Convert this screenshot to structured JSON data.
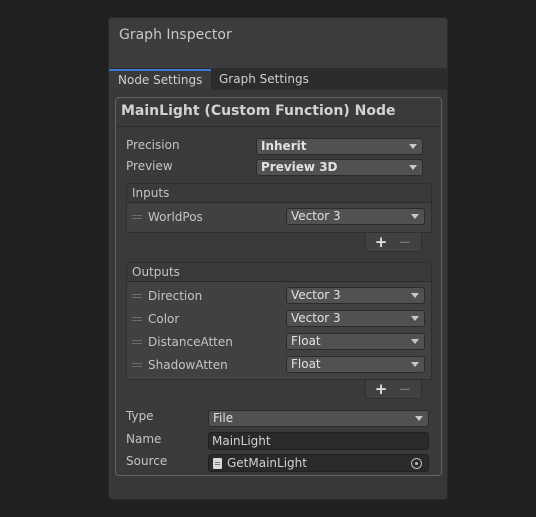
{
  "window": {
    "title": "Graph Inspector"
  },
  "tabs": [
    {
      "label": "Node Settings",
      "active": true
    },
    {
      "label": "Graph Settings",
      "active": false
    }
  ],
  "node": {
    "title": "MainLight (Custom Function) Node",
    "precision": {
      "label": "Precision",
      "value": "Inherit"
    },
    "preview": {
      "label": "Preview",
      "value": "Preview 3D"
    },
    "inputs": {
      "header": "Inputs",
      "rows": [
        {
          "name": "WorldPos",
          "type": "Vector 3"
        }
      ]
    },
    "outputs": {
      "header": "Outputs",
      "rows": [
        {
          "name": "Direction",
          "type": "Vector 3"
        },
        {
          "name": "Color",
          "type": "Vector 3"
        },
        {
          "name": "DistanceAtten",
          "type": "Float"
        },
        {
          "name": "ShadowAtten",
          "type": "Float"
        }
      ]
    },
    "list_buttons": {
      "add": "+",
      "remove": "−"
    },
    "type_field": {
      "label": "Type",
      "value": "File"
    },
    "name_field": {
      "label": "Name",
      "value": "MainLight"
    },
    "source_field": {
      "label": "Source",
      "value": "GetMainLight"
    }
  },
  "icons": [
    "file-icon",
    "object-picker-icon",
    "drag-handle-icon",
    "dropdown-arrow-icon"
  ],
  "colors": {
    "accent_tab": "#3a7ad6",
    "panel_bg": "#383838",
    "background": "#202020"
  }
}
